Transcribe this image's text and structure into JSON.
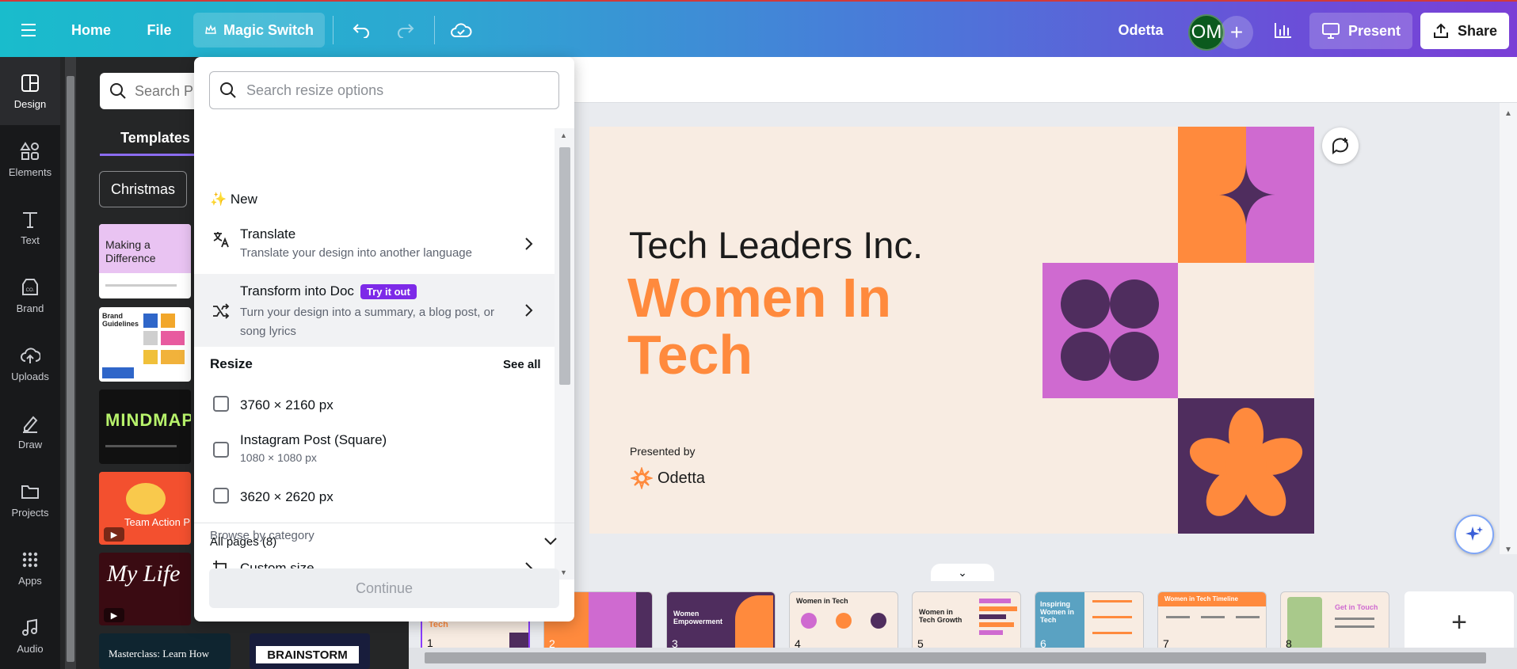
{
  "topbar": {
    "home": "Home",
    "file": "File",
    "magic_switch": "Magic Switch",
    "design_name": "Odetta",
    "avatar_initials": "OM",
    "present": "Present",
    "share": "Share"
  },
  "rail": {
    "items": [
      {
        "label": "Design",
        "icon": "design-icon"
      },
      {
        "label": "Elements",
        "icon": "elements-icon"
      },
      {
        "label": "Text",
        "icon": "text-icon"
      },
      {
        "label": "Brand",
        "icon": "brand-icon"
      },
      {
        "label": "Uploads",
        "icon": "uploads-icon"
      },
      {
        "label": "Draw",
        "icon": "draw-icon"
      },
      {
        "label": "Projects",
        "icon": "projects-icon"
      },
      {
        "label": "Apps",
        "icon": "apps-icon"
      },
      {
        "label": "Audio",
        "icon": "audio-icon"
      }
    ]
  },
  "panel": {
    "search_placeholder": "Search P",
    "tab_templates": "Templates",
    "chip": "Christmas",
    "templates": [
      {
        "title": "Making a Difference"
      },
      {
        "title": "Brand Guidelines"
      },
      {
        "title": "MINDMAP"
      },
      {
        "title": "Team Action Pl"
      },
      {
        "title": "My Life"
      },
      {
        "title": "Masterclass: Learn How"
      },
      {
        "title": "BRAINSTORM"
      }
    ]
  },
  "dropdown": {
    "search_placeholder": "Search resize options",
    "new_label": "✨ New",
    "translate": {
      "title": "Translate",
      "subtitle": "Translate your design into another language"
    },
    "transform": {
      "title": "Transform into Doc",
      "badge": "Try it out",
      "subtitle_line1": "Turn your design into a summary, a blog post, or",
      "subtitle_line2": "song lyrics"
    },
    "resize_label": "Resize",
    "see_all": "See all",
    "options": [
      {
        "title": "3760 × 2160 px",
        "subtitle": ""
      },
      {
        "title": "Instagram Post (Square)",
        "subtitle": "1080 × 1080 px"
      },
      {
        "title": "3620 × 2620 px",
        "subtitle": ""
      }
    ],
    "browse_label": "Browse by category",
    "custom_size": "Custom size",
    "all_pages": "All pages (8)",
    "continue": "Continue"
  },
  "slide": {
    "company": "Tech Leaders Inc.",
    "title_line1": "Women In",
    "title_line2": "Tech",
    "presented_by": "Presented by",
    "presenter": "Odetta",
    "colors": {
      "orange": "#ff8a3d",
      "purple": "#4f2d5e",
      "pink": "#cf6ad0",
      "cream": "#f8ece2"
    }
  },
  "pages": [
    {
      "num": "1"
    },
    {
      "num": "2"
    },
    {
      "num": "3"
    },
    {
      "num": "4"
    },
    {
      "num": "5"
    },
    {
      "num": "6"
    },
    {
      "num": "7"
    },
    {
      "num": "8"
    }
  ],
  "page_texts": {
    "p1": "Tech",
    "p3": "Women Empowerment",
    "p4": "Women in Tech",
    "p5": "Women in Tech Growth",
    "p6": "Inspiring Women in Tech",
    "p7": "Women in Tech Timeline",
    "p8": "Get in Touch"
  },
  "add_page": "+"
}
